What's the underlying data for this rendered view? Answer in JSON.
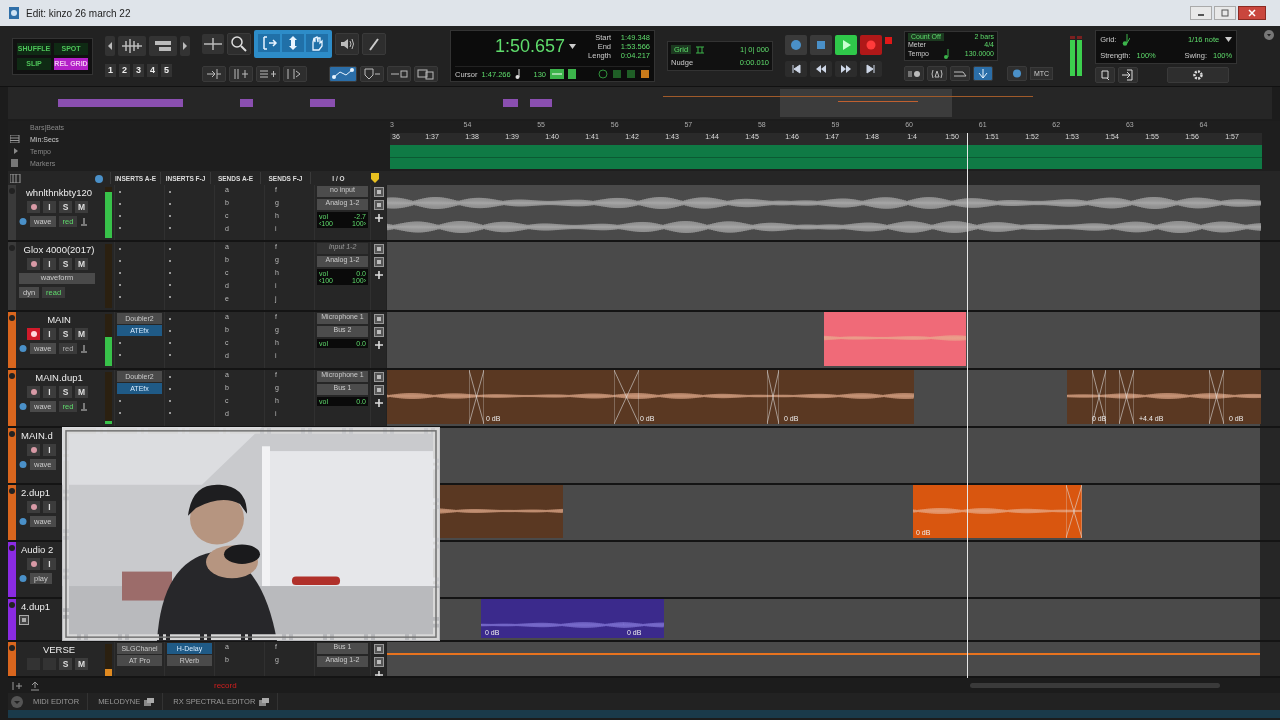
{
  "window": {
    "title": "Edit: kinzo 26 march 22"
  },
  "edit_modes": [
    {
      "label": "SHUFFLE",
      "selected": false
    },
    {
      "label": "SPOT",
      "selected": false
    },
    {
      "label": "SLIP",
      "selected": false
    },
    {
      "label": "REL GRID",
      "selected": true
    }
  ],
  "zoom_presets": [
    "1",
    "2",
    "3",
    "4",
    "5"
  ],
  "smart_tool": true,
  "counter": {
    "main": "1:50.657",
    "start_label": "Start",
    "start": "1:49.348",
    "end_label": "End",
    "end": "1:53.566",
    "length_label": "Length",
    "length": "0:04.217",
    "cursor_label": "Cursor",
    "cursor": "1:47.266",
    "tempo": "130"
  },
  "grid": {
    "label": "Grid",
    "value": "1| 0| 000",
    "nudge_label": "Nudge",
    "nudge": "0:00.010"
  },
  "transport": {
    "playing": true,
    "record_armed": true
  },
  "count_off": {
    "label": "Count Off",
    "value": "2 bars",
    "meter_label": "Meter",
    "meter": "4/4",
    "tempo_label": "Tempo",
    "tempo": "130.0000"
  },
  "mtc": "MTC",
  "quantize": {
    "grid_label": "Grid:",
    "grid": "1/16 note",
    "strength_label": "Strength:",
    "strength": "100%",
    "swing_label": "Swing:",
    "swing": "100%"
  },
  "rulers": [
    "Bars|Beats",
    "Min:Secs",
    "Tempo",
    "Markers"
  ],
  "bars": [
    "3",
    "54",
    "55",
    "56",
    "57",
    "58",
    "59",
    "60",
    "61",
    "62",
    "63",
    "64"
  ],
  "times": [
    "36",
    "1:37",
    "1:38",
    "1:39",
    "1:40",
    "1:41",
    "1:42",
    "1:43",
    "1:44",
    "1:45",
    "1:46",
    "1:47",
    "1:48",
    "1:4",
    "1:50",
    "1:51",
    "1:52",
    "1:53",
    "1:54",
    "1:55",
    "1:56",
    "1:57"
  ],
  "columns": [
    "INSERTS A-E",
    "INSERTS F-J",
    "SENDS A-E",
    "SENDS F-J",
    "I / O"
  ],
  "tracks": [
    {
      "kind": "compact",
      "name": "whnlthnkbty120",
      "rec_armed": false,
      "buttons": [
        "I",
        "S",
        "M"
      ],
      "view": "wave",
      "automation": {
        "label": "red",
        "on": true
      },
      "level": 0.9,
      "inserts_ae": [
        {
          "kind": "empty"
        },
        {
          "kind": "empty"
        },
        {
          "kind": "empty"
        },
        {
          "kind": "empty"
        }
      ],
      "inserts_fj": [
        {
          "kind": "empty"
        },
        {
          "kind": "empty"
        },
        {
          "kind": "empty"
        },
        {
          "kind": "empty"
        }
      ],
      "sends_ae": [
        "a",
        "b",
        "c",
        "d"
      ],
      "sends_fj": [
        "f",
        "g",
        "h",
        "i"
      ],
      "io": {
        "input": "no input",
        "input_disabled": false,
        "output": "Analog 1-2",
        "vol_label": "vol",
        "vol": "-2.7",
        "pan_left": "‹100",
        "pan_right": "100›"
      },
      "lane": {
        "kind": "waveform"
      }
    },
    {
      "kind": "tall",
      "name": "Glox 4000(2017)",
      "rec_armed": false,
      "buttons": [
        "I",
        "S",
        "M"
      ],
      "view": "waveform",
      "dyn": "dyn",
      "automation": {
        "label": "read",
        "on": true
      },
      "inserts_ae": [
        {
          "kind": "empty"
        },
        {
          "kind": "empty"
        },
        {
          "kind": "empty"
        },
        {
          "kind": "empty"
        },
        {
          "kind": "empty"
        }
      ],
      "inserts_fj": [
        {
          "kind": "empty"
        },
        {
          "kind": "empty"
        },
        {
          "kind": "empty"
        },
        {
          "kind": "empty"
        },
        {
          "kind": "empty"
        }
      ],
      "sends_ae": [
        "a",
        "b",
        "c",
        "d",
        "e"
      ],
      "sends_fj": [
        "f",
        "g",
        "h",
        "i",
        "j"
      ],
      "io": {
        "input": "Input 1-2",
        "input_disabled": true,
        "output": "Analog 1-2",
        "vol_label": "vol",
        "vol": "0.0",
        "pan_left": "‹100",
        "pan_right": "100›"
      },
      "lane": {
        "kind": "empty"
      }
    },
    {
      "kind": "compact",
      "name": "MAIN",
      "color": "#d9661e",
      "rec_armed": true,
      "buttons": [
        "I",
        "S",
        "M"
      ],
      "view": "wave",
      "automation": {
        "label": "red",
        "on": false
      },
      "level": 0.55,
      "inserts_ae": [
        {
          "kind": "plugin",
          "name": "Doubler2",
          "selected": false
        },
        {
          "kind": "plugin",
          "name": "ATEfx",
          "selected": true
        },
        {
          "kind": "empty"
        },
        {
          "kind": "empty"
        }
      ],
      "inserts_fj": [
        {
          "kind": "empty"
        },
        {
          "kind": "empty"
        },
        {
          "kind": "empty"
        },
        {
          "kind": "empty"
        }
      ],
      "sends_ae": [
        "a",
        "b",
        "c",
        "d"
      ],
      "sends_fj": [
        "f",
        "g",
        "h",
        "i"
      ],
      "io": {
        "input": "Microphone 1",
        "input_disabled": false,
        "output": "Bus 2",
        "vol_label": "vol",
        "vol": "0.0"
      },
      "lane": {
        "kind": "empty"
      },
      "clips": [
        {
          "color": "#f06a78"
        }
      ]
    },
    {
      "kind": "compact",
      "name": "MAIN.dup1",
      "color": "#d9661e",
      "rec_armed": false,
      "buttons": [
        "I",
        "S",
        "M"
      ],
      "view": "wave",
      "automation": {
        "label": "red",
        "on": true
      },
      "level": 0.05,
      "inserts_ae": [
        {
          "kind": "plugin",
          "name": "Doubler2",
          "selected": false
        },
        {
          "kind": "plugin",
          "name": "ATEfx",
          "selected": true
        },
        {
          "kind": "empty"
        },
        {
          "kind": "empty"
        }
      ],
      "inserts_fj": [
        {
          "kind": "empty"
        },
        {
          "kind": "empty"
        },
        {
          "kind": "empty"
        },
        {
          "kind": "empty"
        }
      ],
      "sends_ae": [
        "a",
        "b",
        "c",
        "d"
      ],
      "sends_fj": [
        "f",
        "g",
        "h",
        "i"
      ],
      "io": {
        "input": "Microphone 1",
        "input_disabled": false,
        "output": "Bus 1",
        "vol_label": "vol",
        "vol": "0.0"
      },
      "lane": {
        "kind": "empty"
      },
      "clips": [
        {
          "color": "#5a3822",
          "labels": [
            "0 dB",
            "0 dB",
            "0 dB"
          ]
        },
        {
          "color": "#5a3822",
          "labels": [
            "0 dB",
            "+4.4 dB",
            "0 dB"
          ]
        }
      ]
    },
    {
      "kind": "covered",
      "name": "MAIN.d",
      "color": "#d9661e",
      "rec_armed": false,
      "buttons": [
        "I"
      ],
      "view": "wave",
      "lane": {
        "kind": "empty"
      }
    },
    {
      "kind": "covered",
      "name": "2.dup1",
      "color": "#d9661e",
      "rec_armed": false,
      "buttons": [
        "I"
      ],
      "view": "wave",
      "lane": {
        "kind": "empty"
      },
      "clips": [
        {
          "color": "#5a3822"
        },
        {
          "color": "#d9560f",
          "labels": [
            "0 dB"
          ]
        }
      ]
    },
    {
      "kind": "covered",
      "name": "Audio 2",
      "color": "#8a2be2",
      "rec_armed": false,
      "buttons": [
        "I"
      ],
      "view": "play",
      "lane": {
        "kind": "empty"
      }
    },
    {
      "kind": "covered",
      "name": "4.dup1",
      "color": "#8a2be2",
      "lane": {
        "kind": "empty"
      },
      "clips": [
        {
          "color": "#3b2a8c",
          "labels": [
            "0 dB"
          ]
        },
        {
          "color": "#3b2a8c",
          "labels": [
            "0 dB"
          ]
        }
      ]
    },
    {
      "kind": "partial",
      "name": "VERSE",
      "color": "#d9661e",
      "buttons": [
        "S",
        "M"
      ],
      "level": 0.3,
      "inserts_ae": [
        {
          "kind": "plugin",
          "name": "SLGChanel",
          "selected": false
        },
        {
          "kind": "plugin",
          "name": "AT Pro",
          "selected": false
        }
      ],
      "inserts_fj": [
        {
          "kind": "plugin",
          "name": "H-Delay",
          "selected": true
        },
        {
          "kind": "plugin",
          "name": "RVerb",
          "selected": false
        }
      ],
      "sends_ae": [
        "a",
        "b"
      ],
      "sends_fj": [
        "f",
        "g"
      ],
      "io": {
        "input": "Bus 1",
        "input_disabled": false,
        "output": "Analog 1-2"
      },
      "lane": {
        "kind": "volume-line"
      }
    }
  ],
  "webcam": {
    "kind": "picture"
  },
  "status": "record",
  "tabs": [
    {
      "label": "MIDI EDITOR"
    },
    {
      "label": "MELODYNE"
    },
    {
      "label": "RX SPECTRAL EDITOR"
    }
  ]
}
